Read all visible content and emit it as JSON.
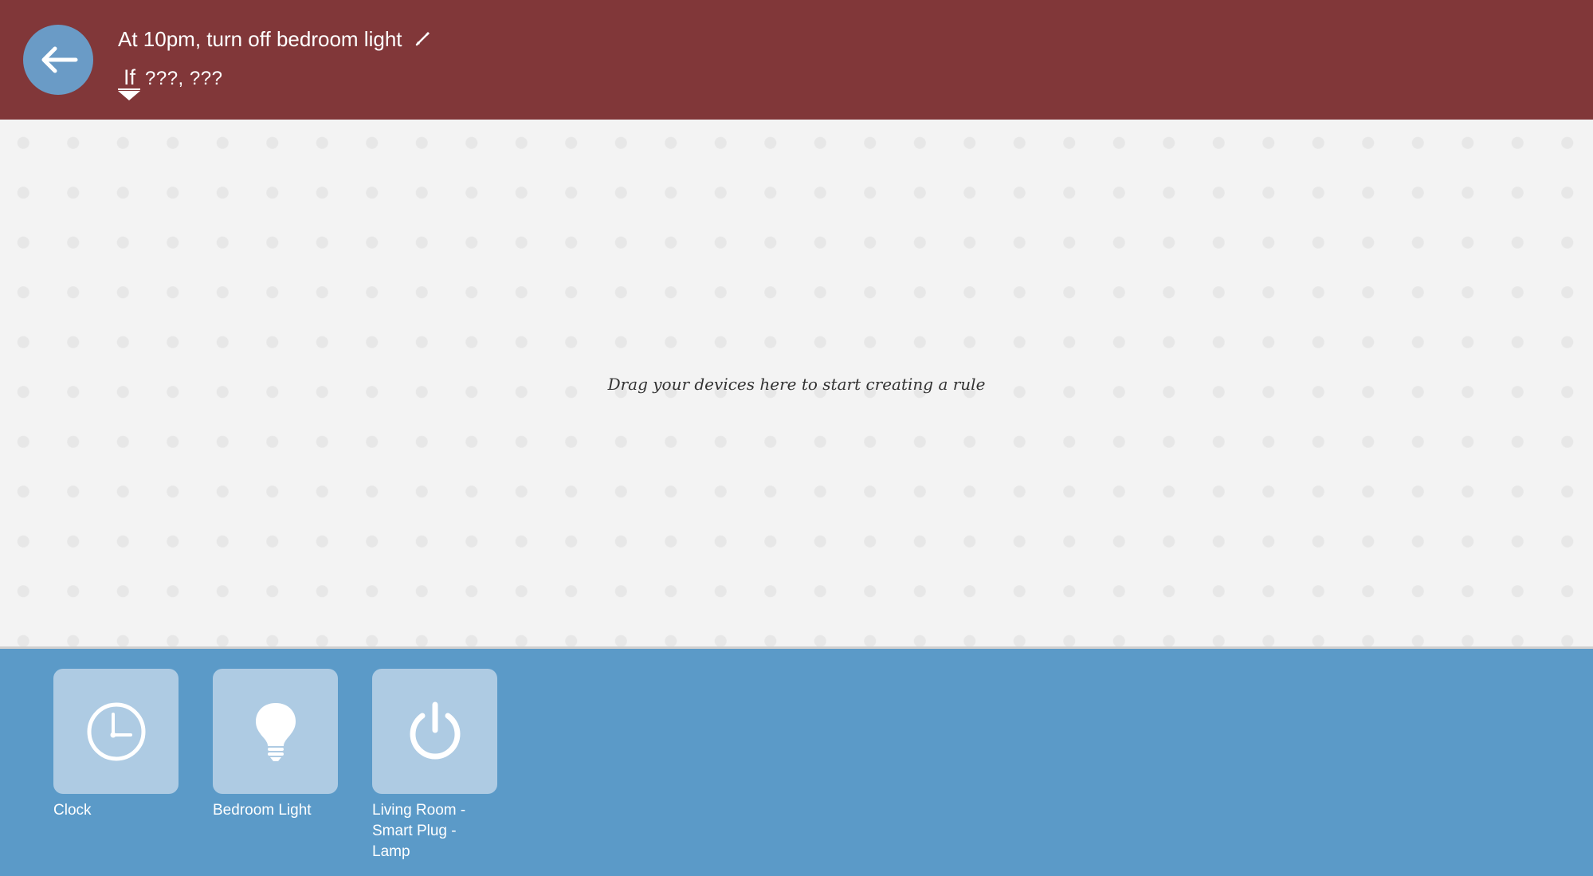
{
  "header": {
    "rule_title": "At 10pm, turn off bedroom light",
    "if_label": "If",
    "summary": "???, ???",
    "back_icon": "arrow-left-icon",
    "edit_icon": "pencil-icon"
  },
  "canvas": {
    "hint": "Drag your devices here to start creating a rule"
  },
  "palette": {
    "devices": [
      {
        "label": "Clock",
        "icon": "clock-icon"
      },
      {
        "label": "Bedroom Light",
        "icon": "lightbulb-icon"
      },
      {
        "label": "Living Room - Smart Plug - Lamp",
        "icon": "power-icon"
      }
    ]
  },
  "colors": {
    "header_bg": "#813739",
    "canvas_bg": "#f3f3f3",
    "palette_bg": "#5b9ac8",
    "tile_bg": "#aecbe3",
    "back_button_bg": "#6a9bc6"
  }
}
